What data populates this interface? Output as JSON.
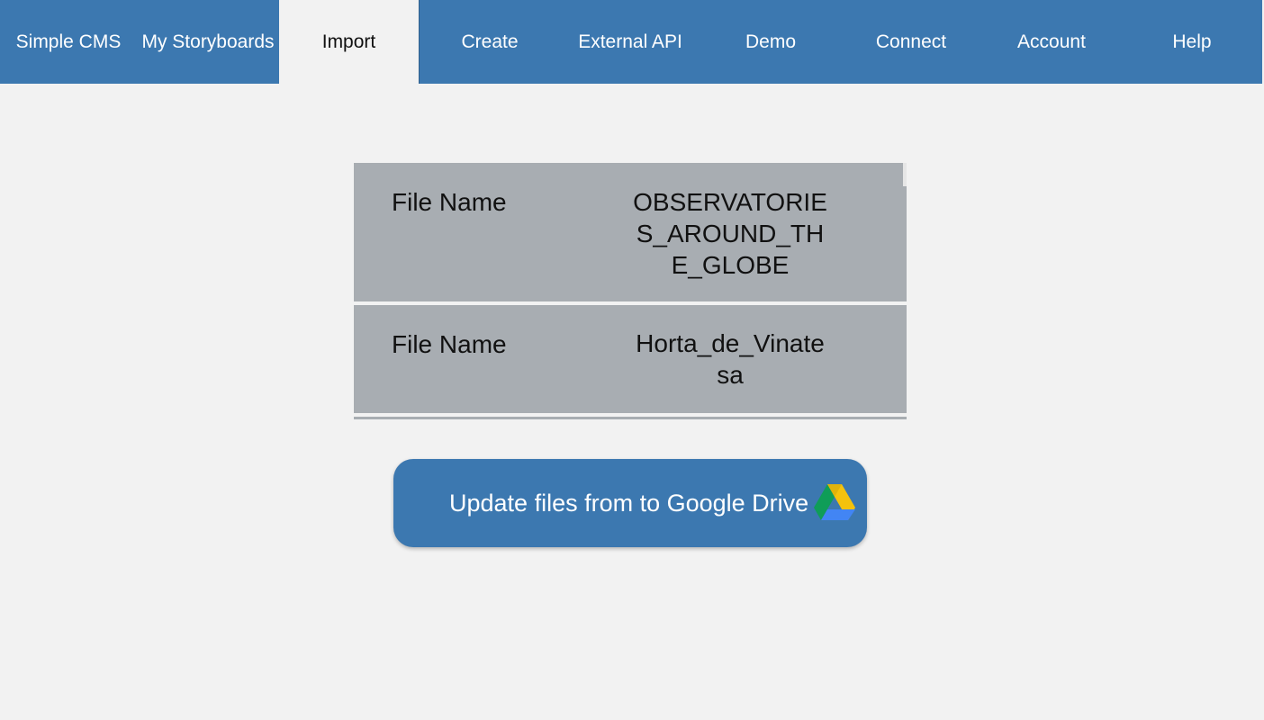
{
  "nav": {
    "tabs": [
      {
        "label": "Simple CMS"
      },
      {
        "label": "My Storyboards"
      },
      {
        "label": "Import",
        "active": true
      },
      {
        "label": "Create"
      },
      {
        "label": "External API"
      },
      {
        "label": "Demo"
      },
      {
        "label": "Connect"
      },
      {
        "label": "Account"
      },
      {
        "label": "Help"
      }
    ]
  },
  "files": [
    {
      "label": "File Name",
      "value": "OBSERVATORIES_AROUND_THE_GLOBE"
    },
    {
      "label": "File Name",
      "value": "Horta_de_Vinatesa"
    }
  ],
  "drive_button": {
    "label": "Update files from to Google Drive",
    "icon": "google-drive-icon"
  },
  "colors": {
    "nav_bg": "#3c78b0",
    "page_bg": "#f2f2f2",
    "row_bg": "#a8adb2",
    "button_bg": "#3c78b0"
  }
}
